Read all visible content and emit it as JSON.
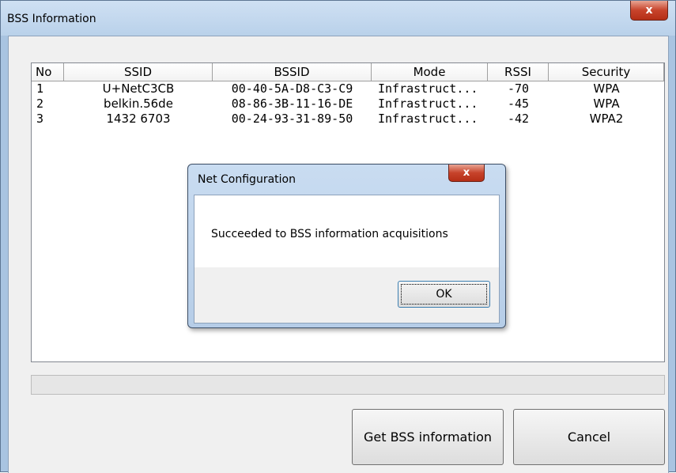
{
  "window": {
    "title": "BSS Information",
    "close_glyph": "x"
  },
  "list": {
    "columns": [
      "No",
      "SSID",
      "BSSID",
      "Mode",
      "RSSI",
      "Security"
    ],
    "rows": [
      [
        "1",
        "U+NetC3CB",
        "00-40-5A-D8-C3-C9",
        "Infrastruct...",
        "-70",
        "WPA"
      ],
      [
        "2",
        "belkin.56de",
        "08-86-3B-11-16-DE",
        "Infrastruct...",
        "-45",
        "WPA"
      ],
      [
        "3",
        "1432 6703",
        "00-24-93-31-89-50",
        "Infrastruct...",
        "-42",
        "WPA2"
      ]
    ]
  },
  "buttons": {
    "get_bss": "Get BSS information",
    "cancel": "Cancel"
  },
  "dialog": {
    "title": "Net Configuration",
    "close_glyph": "x",
    "message": "Succeeded to BSS information acquisitions",
    "ok": "OK"
  },
  "colors": {
    "title_bar": "#b9d1ea",
    "close_button": "#c7432b",
    "client_bg": "#f0f0f0"
  }
}
